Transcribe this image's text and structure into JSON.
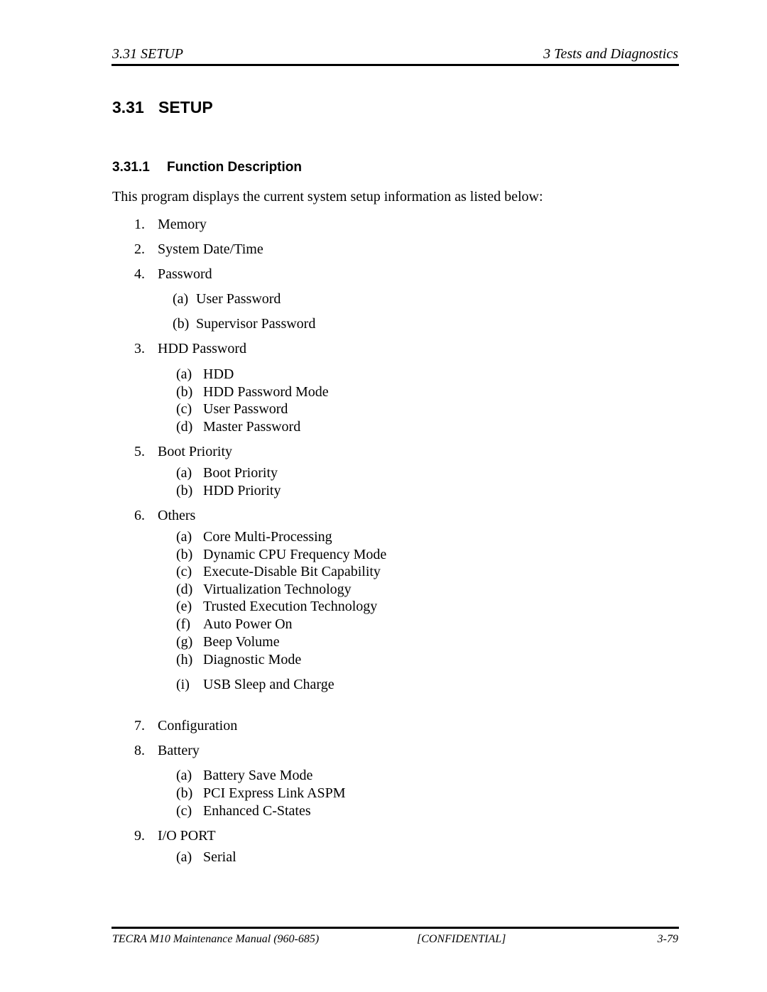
{
  "header": {
    "left": "3.31 SETUP",
    "right": "3 Tests and Diagnostics"
  },
  "section": {
    "number": "3.31",
    "title": "SETUP"
  },
  "subsection": {
    "number": "3.31.1",
    "title": "Function Description"
  },
  "intro": "This program displays the current system setup information as listed below:",
  "items": [
    {
      "marker": "1.",
      "label": "Memory"
    },
    {
      "marker": "2.",
      "label": "System Date/Time"
    },
    {
      "marker": "4.",
      "label": "Password"
    },
    {
      "marker": "(a)",
      "label": "User Password"
    },
    {
      "marker": "(b)",
      "label": "Supervisor Password"
    },
    {
      "marker": "3.",
      "label": "HDD Password"
    },
    {
      "marker": "(a)",
      "label": "HDD"
    },
    {
      "marker": "(b)",
      "label": "HDD Password Mode"
    },
    {
      "marker": "(c)",
      "label": "User Password"
    },
    {
      "marker": "(d)",
      "label": "Master Password"
    },
    {
      "marker": "5.",
      "label": "Boot Priority"
    },
    {
      "marker": "(a)",
      "label": "Boot Priority"
    },
    {
      "marker": "(b)",
      "label": "HDD Priority"
    },
    {
      "marker": "6.",
      "label": "Others"
    },
    {
      "marker": "(a)",
      "label": "Core Multi-Processing"
    },
    {
      "marker": "(b)",
      "label": "Dynamic CPU Frequency Mode"
    },
    {
      "marker": "(c)",
      "label": "Execute-Disable Bit Capability"
    },
    {
      "marker": "(d)",
      "label": "Virtualization Technology"
    },
    {
      "marker": "(e)",
      "label": "Trusted Execution Technology"
    },
    {
      "marker": "(f)",
      "label": "Auto Power On"
    },
    {
      "marker": "(g)",
      "label": "Beep Volume"
    },
    {
      "marker": "(h)",
      "label": "Diagnostic Mode"
    },
    {
      "marker": "(i)",
      "label": "USB Sleep and Charge"
    },
    {
      "marker": "7.",
      "label": "Configuration"
    },
    {
      "marker": "8.",
      "label": "Battery"
    },
    {
      "marker": "(a)",
      "label": "Battery Save Mode"
    },
    {
      "marker": "(b)",
      "label": "PCI Express Link ASPM"
    },
    {
      "marker": "(c)",
      "label": "Enhanced C-States"
    },
    {
      "marker": "9.",
      "label": "I/O PORT"
    },
    {
      "marker": "(a)",
      "label": "Serial"
    }
  ],
  "footer": {
    "left": "TECRA M10 Maintenance Manual (960-685)",
    "middle": "[CONFIDENTIAL]",
    "right": "3-79"
  }
}
